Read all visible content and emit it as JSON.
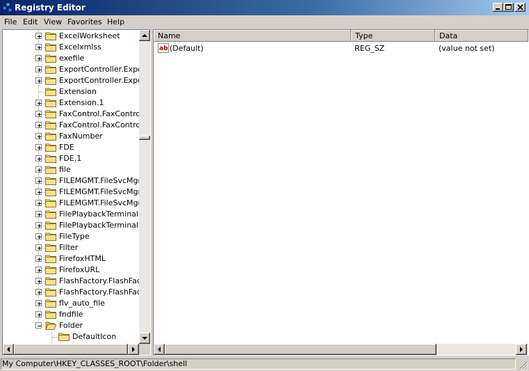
{
  "window": {
    "title": "Registry Editor"
  },
  "menu": [
    "File",
    "Edit",
    "View",
    "Favorites",
    "Help"
  ],
  "tree": {
    "items": [
      {
        "label": "ExcelWorksheet",
        "state": "collapsed"
      },
      {
        "label": "Excelxmlss",
        "state": "collapsed"
      },
      {
        "label": "exefile",
        "state": "collapsed"
      },
      {
        "label": "ExportController.Export",
        "state": "collapsed"
      },
      {
        "label": "ExportController.Export",
        "state": "collapsed"
      },
      {
        "label": "Extension",
        "state": "none"
      },
      {
        "label": "Extension.1",
        "state": "collapsed"
      },
      {
        "label": "FaxControl.FaxControl",
        "state": "collapsed"
      },
      {
        "label": "FaxControl.FaxControl.",
        "state": "collapsed"
      },
      {
        "label": "FaxNumber",
        "state": "collapsed"
      },
      {
        "label": "FDE",
        "state": "collapsed"
      },
      {
        "label": "FDE.1",
        "state": "collapsed"
      },
      {
        "label": "file",
        "state": "collapsed"
      },
      {
        "label": "FILEMGMT.FileSvcMgmtA",
        "state": "collapsed"
      },
      {
        "label": "FILEMGMT.FileSvcMgmtE",
        "state": "collapsed"
      },
      {
        "label": "FILEMGMT.FileSvcMgmtC",
        "state": "collapsed"
      },
      {
        "label": "FilePlaybackTerminal.File",
        "state": "collapsed"
      },
      {
        "label": "FilePlaybackTerminal.File",
        "state": "collapsed"
      },
      {
        "label": "FileType",
        "state": "collapsed"
      },
      {
        "label": "Filter",
        "state": "collapsed"
      },
      {
        "label": "FirefoxHTML",
        "state": "collapsed"
      },
      {
        "label": "FirefoxURL",
        "state": "collapsed"
      },
      {
        "label": "FlashFactory.FlashFacto",
        "state": "collapsed"
      },
      {
        "label": "FlashFactory.FlashFacto",
        "state": "collapsed"
      },
      {
        "label": "flv_auto_file",
        "state": "collapsed"
      },
      {
        "label": "fndfile",
        "state": "collapsed"
      },
      {
        "label": "Folder",
        "state": "expanded"
      },
      {
        "label": "DefaultIcon",
        "state": "child"
      }
    ],
    "scroll_position": 0.33
  },
  "list": {
    "columns": [
      "Name",
      "Type",
      "Data"
    ],
    "rows": [
      {
        "name": "(Default)",
        "type": "REG_SZ",
        "data": "(value not set)",
        "icon": "string-value-icon"
      }
    ]
  },
  "status": {
    "path": "My Computer\\HKEY_CLASSES_ROOT\\Folder\\shell"
  }
}
